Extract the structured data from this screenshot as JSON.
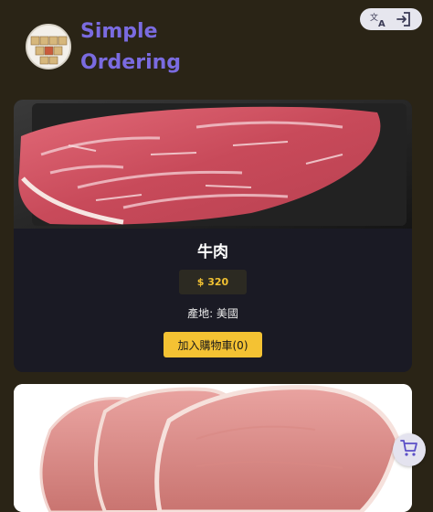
{
  "header": {
    "brand_line1": "Simple",
    "brand_line2": "Ordering",
    "brand_color": "#7a6be0",
    "language_icon": "translate-icon",
    "login_icon": "login-icon"
  },
  "products": [
    {
      "name": "牛肉",
      "price": "$ 320",
      "origin": "產地: 美國",
      "add_to_cart": "加入購物車(0)",
      "image": "beef-steak-photo"
    },
    {
      "image": "pork-chop-photo"
    }
  ],
  "cart_fab": {
    "icon": "shopping-cart-icon"
  },
  "colors": {
    "background": "#2a2416",
    "card": "#1a1a24",
    "accent": "#f4c233",
    "price_text": "#f2c232"
  }
}
